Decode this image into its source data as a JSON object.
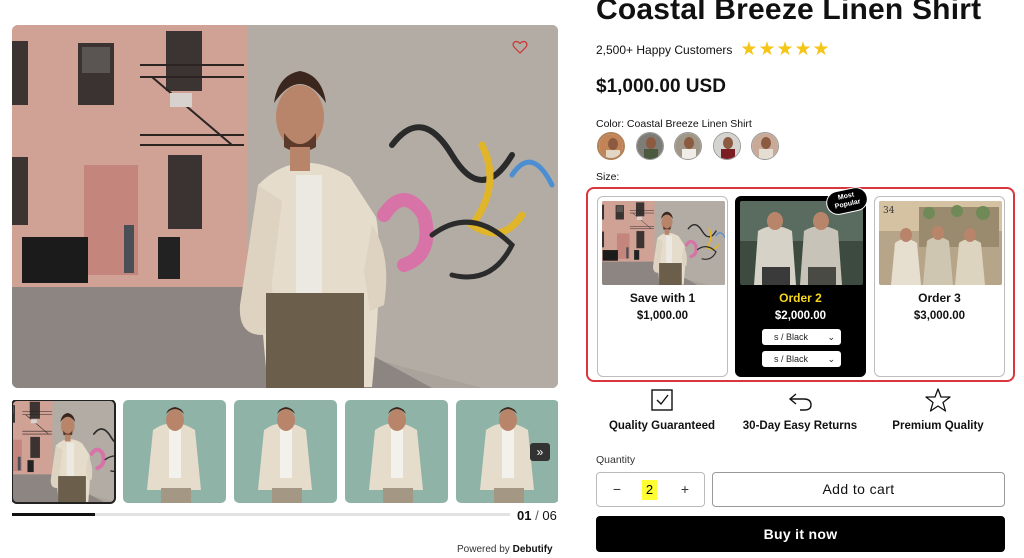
{
  "gallery": {
    "counter_current": "01",
    "counter_separator": "/",
    "counter_total": "06",
    "progress": 0.166,
    "next_icon": "»"
  },
  "footer": {
    "powered_prefix": "Powered by",
    "powered_brand": "Debutify"
  },
  "product": {
    "title": "Coastal Breeze Linen Shirt",
    "reviews_text": "2,500+ Happy Customers",
    "rating_stars": 5,
    "stars_display": "★★★★★",
    "price": "$1,000.00 USD",
    "color_label": "Color: Coastal Breeze Linen Shirt",
    "size_label": "Size:"
  },
  "bundles": [
    {
      "name": "Save with 1",
      "price": "$1,000.00"
    },
    {
      "name": "Order 2",
      "price": "$2,000.00",
      "badge": "Most Popular",
      "variant_1": "s / Black",
      "variant_2": "s / Black"
    },
    {
      "name": "Order 3",
      "price": "$3,000.00"
    }
  ],
  "features": [
    {
      "label": "Quality Guaranteed",
      "icon": "checkbox-icon"
    },
    {
      "label": "30-Day Easy Returns",
      "icon": "return-arrow-icon"
    },
    {
      "label": "Premium Quality",
      "icon": "star-outline-icon"
    }
  ],
  "purchase": {
    "quantity_label": "Quantity",
    "quantity": "2",
    "minus": "−",
    "plus": "+",
    "add_to_cart": "Add to cart",
    "buy_now": "Buy it now"
  },
  "colors": {
    "accent_star": "#f5c518",
    "highlight_frame": "#d9363e",
    "popular_title": "#f7d61b",
    "quantity_highlight": "#ffff33"
  }
}
